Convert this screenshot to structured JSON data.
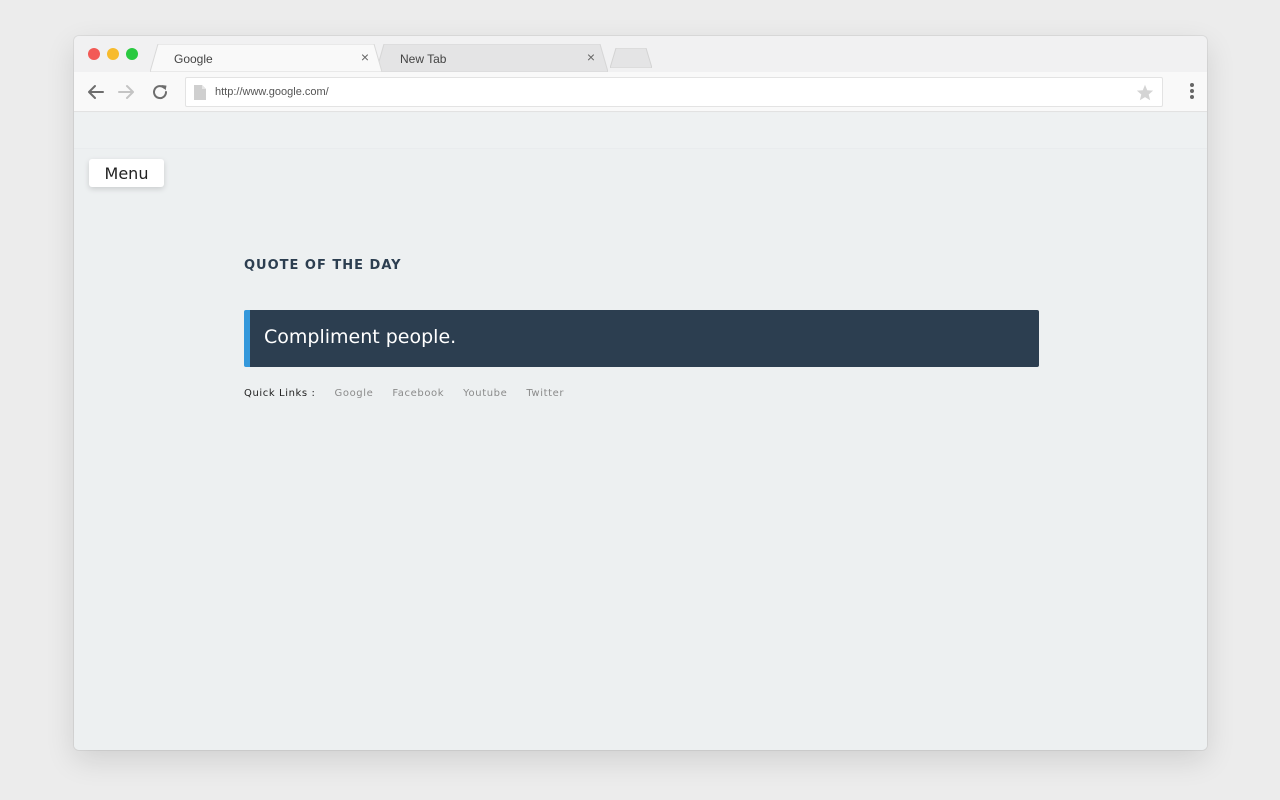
{
  "browser": {
    "tabs": [
      {
        "title": "Google",
        "active": true
      },
      {
        "title": "New Tab",
        "active": false
      }
    ],
    "url": "http://www.google.com/",
    "close_glyph": "×"
  },
  "page": {
    "menu_label": "Menu",
    "quote_heading": "QUOTE OF THE DAY",
    "quote_text": "Compliment people.",
    "quick_links_label": "Quick Links :",
    "quick_links": [
      "Google",
      "Facebook",
      "Youtube",
      "Twitter"
    ]
  },
  "colors": {
    "quote_bg": "#2c3e50",
    "quote_accent": "#3498db",
    "heading": "#2c3e50"
  },
  "icons": {
    "back": "arrow-left-icon",
    "forward": "arrow-right-icon",
    "reload": "reload-icon",
    "page": "document-icon",
    "bookmark": "star-icon",
    "menu": "kebab-menu-icon"
  }
}
